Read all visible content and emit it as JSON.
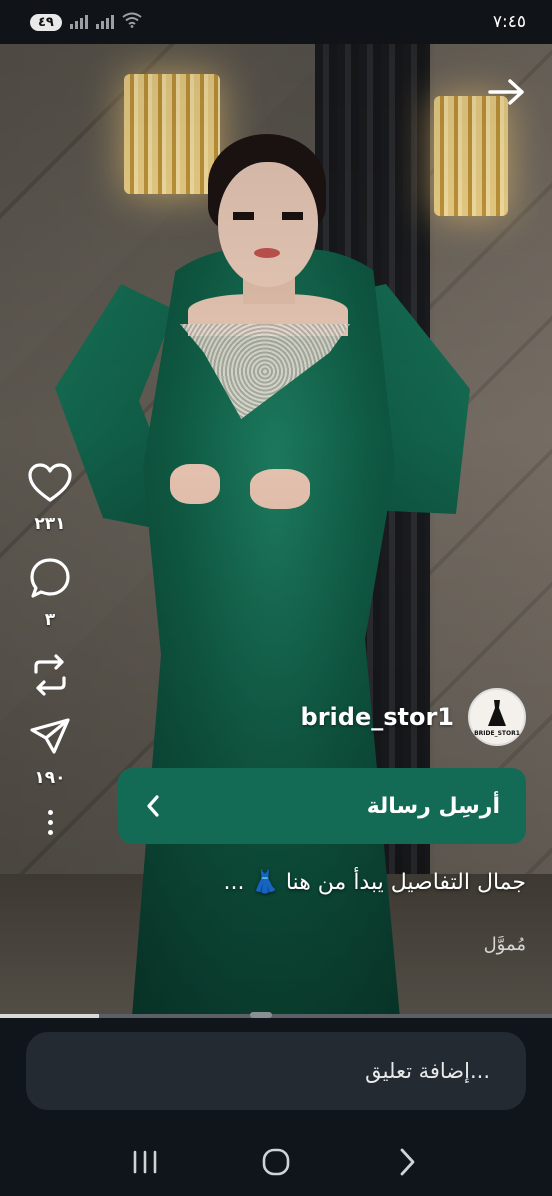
{
  "status_bar": {
    "battery": "٤٩",
    "time": "٧:٤٥"
  },
  "post": {
    "author": "bride_stor1",
    "avatar_text": "BRIDE_STOR1",
    "message_button": "أرسِل رسالة",
    "caption": "جمال التفاصيل يبدأ من هنا 👗 ...",
    "sponsored_label": "مُموَّل",
    "video_progress": 0.18
  },
  "actions": {
    "likes": "٢٣١",
    "comments": "٣",
    "shares": "١٩٠"
  },
  "comment_input": {
    "placeholder": "إضافة تعليق..."
  },
  "icons": [
    "back-arrow-icon",
    "heart-icon",
    "comment-icon",
    "repost-icon",
    "send-icon",
    "more-icon",
    "chevron-left-icon",
    "recent-apps-icon",
    "home-icon",
    "back-nav-icon"
  ],
  "colors": {
    "accent": "#146b55",
    "background": "#0f151b"
  }
}
